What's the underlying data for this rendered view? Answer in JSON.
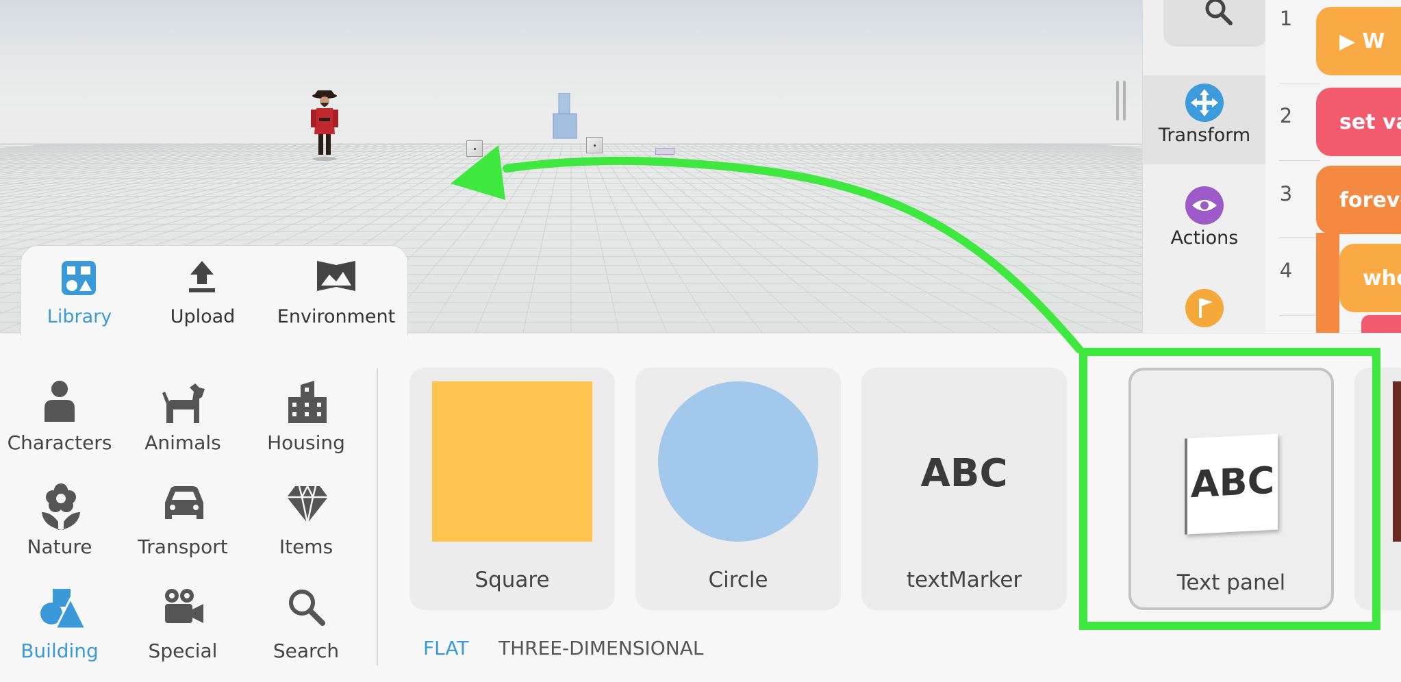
{
  "category_rail": {
    "items": [
      {
        "label": "Transform",
        "icon": "transform-icon",
        "color": "#3d9bdc"
      },
      {
        "label": "Actions",
        "icon": "eye-icon",
        "color": "#9c5bc8"
      },
      {
        "label": "",
        "icon": "flag-icon",
        "color": "#f4a93a"
      }
    ]
  },
  "code_panel": {
    "line_numbers": [
      "1",
      "2",
      "3",
      "4"
    ],
    "blocks": [
      {
        "text": "▶ W",
        "color": "#f9aa45"
      },
      {
        "text": "set va",
        "color": "#f25a6e"
      },
      {
        "text": "foreve",
        "color": "#f48a42"
      },
      {
        "text": "whe",
        "color": "#f9aa45"
      }
    ]
  },
  "top_tabs": [
    {
      "label": "Library",
      "icon": "library-icon",
      "active": true
    },
    {
      "label": "Upload",
      "icon": "upload-icon",
      "active": false
    },
    {
      "label": "Environment",
      "icon": "environment-icon",
      "active": false
    }
  ],
  "categories": [
    {
      "label": "Characters",
      "icon": "person-icon"
    },
    {
      "label": "Animals",
      "icon": "dog-icon"
    },
    {
      "label": "Housing",
      "icon": "building-icon"
    },
    {
      "label": "Nature",
      "icon": "flower-icon"
    },
    {
      "label": "Transport",
      "icon": "car-icon"
    },
    {
      "label": "Items",
      "icon": "diamond-icon"
    },
    {
      "label": "Building",
      "icon": "shapes-icon",
      "active": true
    },
    {
      "label": "Special",
      "icon": "camera-icon"
    },
    {
      "label": "Search",
      "icon": "search-icon"
    }
  ],
  "objects": [
    {
      "label": "Square",
      "preview_color": "#fec44f"
    },
    {
      "label": "Circle",
      "preview_color": "#a2c8ec"
    },
    {
      "label": "textMarker",
      "preview_text": "ABC"
    },
    {
      "label": "Text panel",
      "preview_text": "ABC",
      "selected": true
    }
  ],
  "sub_tabs": [
    {
      "label": "FLAT",
      "active": true
    },
    {
      "label": "THREE-DIMENSIONAL",
      "active": false
    }
  ],
  "colors": {
    "accent": "#3a9ad9",
    "highlight": "#3ee83e"
  }
}
